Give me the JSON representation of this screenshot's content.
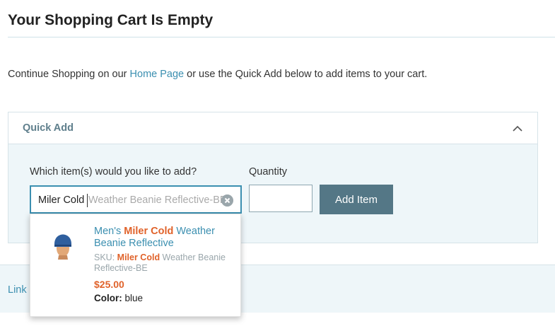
{
  "page": {
    "title": "Your Shopping Cart Is Empty",
    "intro_before": "Continue Shopping on our ",
    "intro_link": "Home Page",
    "intro_after": " or use the Quick Add below to add items to your cart."
  },
  "quick_add": {
    "title": "Quick Add",
    "item_label": "Which item(s) would you like to add?",
    "item_value": "Miler Cold ",
    "item_suggestion": "Weather Beanie Reflective-BE",
    "quantity_label": "Quantity",
    "quantity_value": "",
    "add_button": "Add Item"
  },
  "suggestion": {
    "name_prefix": "Men's ",
    "name_match": "Miler Cold",
    "name_suffix": " Weather Beanie Reflective",
    "sku_prefix": "SKU: ",
    "sku_match": "Miler Cold",
    "sku_suffix": " Weather Beanie Reflective-BE",
    "price": "$25.00",
    "color_label": "Color:",
    "color_value": "blue",
    "thumbnail": "blue-beanie-on-head"
  },
  "footer": {
    "link": "Link"
  },
  "colors": {
    "accent": "#3b8fb0",
    "highlight": "#e0622a",
    "button": "#547786",
    "panel_bg": "#eef6f9"
  }
}
